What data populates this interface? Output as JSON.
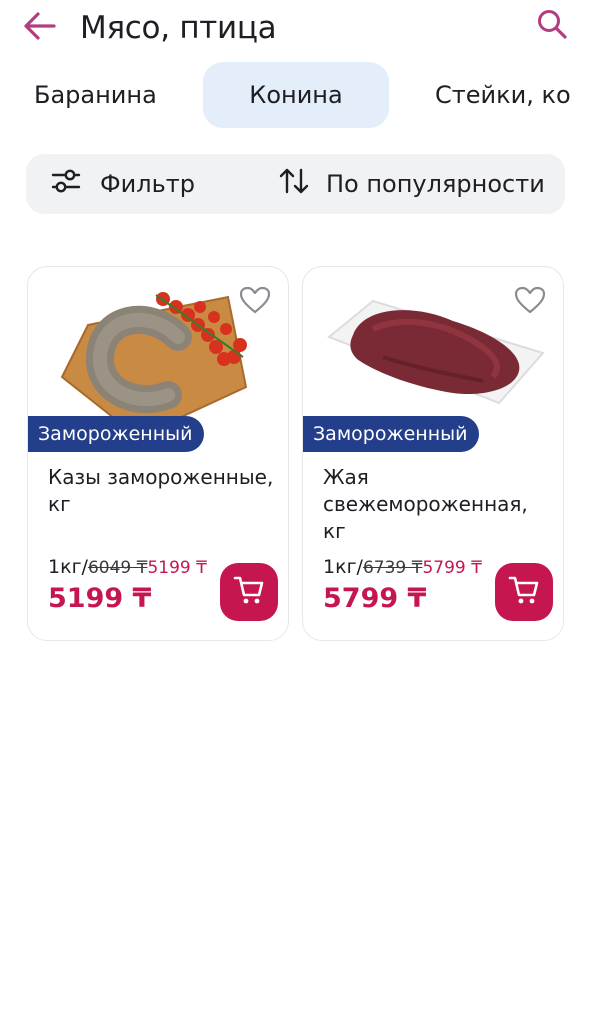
{
  "header": {
    "title": "Мясо, птица",
    "back_icon": "arrow-left-icon",
    "search_icon": "search-icon",
    "accent_color": "#b33d7e"
  },
  "tabs": [
    {
      "label": "Баранина",
      "active": false
    },
    {
      "label": "Конина",
      "active": true
    },
    {
      "label": "Стейки, ко",
      "active": false
    }
  ],
  "toolbar": {
    "filter_label": "Фильтр",
    "filter_icon": "sliders-icon",
    "sort_label": "По популярности",
    "sort_icon": "sort-arrows-icon"
  },
  "products": [
    {
      "name": "Казы замороженные, кг",
      "badge": "Замороженный",
      "unit": "1кг/",
      "old_price": "6049 ₸",
      "new_price": "5199 ₸",
      "price": "5199 ₸",
      "favorite_icon": "heart-outline-icon",
      "cart_icon": "cart-icon"
    },
    {
      "name": "Жая свежемороженная, кг",
      "badge": "Замороженный",
      "unit": "1кг/",
      "old_price": "6739 ₸",
      "new_price": "5799 ₸",
      "price": "5799 ₸",
      "favorite_icon": "heart-outline-icon",
      "cart_icon": "cart-icon"
    }
  ],
  "colors": {
    "price": "#c5164f",
    "badge_bg": "#233e8b",
    "active_tab_bg": "#e4edfa",
    "toolbar_bg": "#f1f2f4"
  }
}
